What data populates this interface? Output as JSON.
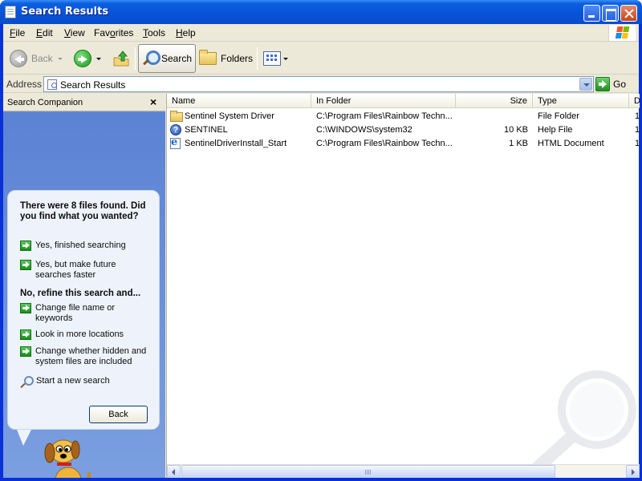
{
  "window": {
    "title": "Search Results"
  },
  "menu": [
    "File",
    "Edit",
    "View",
    "Favorites",
    "Tools",
    "Help"
  ],
  "menu_mnemonic_index": [
    0,
    0,
    0,
    3,
    0,
    0
  ],
  "toolbar": {
    "back_label": "Back",
    "search_label": "Search",
    "folders_label": "Folders"
  },
  "address": {
    "label": "Address",
    "value": "Search Results",
    "go_label": "Go"
  },
  "companion": {
    "title": "Search Companion",
    "close_glyph": "×",
    "question": "There were 8 files found. Did you find what you wanted?",
    "options_done": [
      "Yes, finished searching",
      "Yes, but make future searches faster"
    ],
    "refine_heading": "No, refine this search and...",
    "options_refine": [
      "Change file name or keywords",
      "Look in more locations",
      "Change whether hidden and system files are included"
    ],
    "new_search": "Start a new search",
    "back_button": "Back"
  },
  "results": {
    "columns": [
      "Name",
      "In Folder",
      "Size",
      "Type",
      "D"
    ],
    "rows": [
      {
        "icon": "folder-icon",
        "name": "Sentinel System Driver",
        "folder": "C:\\Program Files\\Rainbow Techn...",
        "size": "",
        "type": "File Folder",
        "d": "1"
      },
      {
        "icon": "help-file-icon",
        "name": "SENTINEL",
        "folder": "C:\\WINDOWS\\system32",
        "size": "10 KB",
        "type": "Help File",
        "d": "1"
      },
      {
        "icon": "html-document-icon",
        "name": "SentinelDriverInstall_Start",
        "folder": "C:\\Program Files\\Rainbow Techn...",
        "size": "1 KB",
        "type": "HTML Document",
        "d": "1"
      }
    ]
  }
}
